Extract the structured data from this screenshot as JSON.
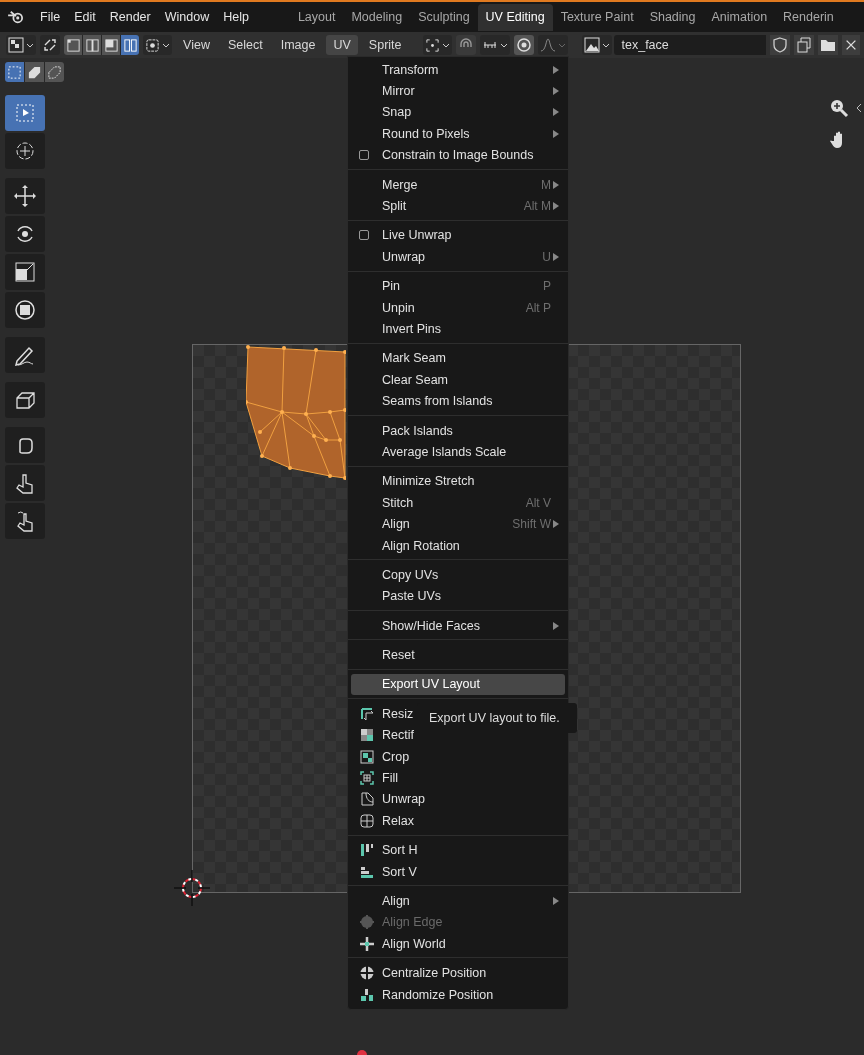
{
  "header": {
    "menus": [
      "File",
      "Edit",
      "Render",
      "Window",
      "Help"
    ],
    "workspaces": [
      {
        "label": "Layout",
        "selected": false
      },
      {
        "label": "Modeling",
        "selected": false
      },
      {
        "label": "Sculpting",
        "selected": false
      },
      {
        "label": "UV Editing",
        "selected": true
      },
      {
        "label": "Texture Paint",
        "selected": false
      },
      {
        "label": "Shading",
        "selected": false
      },
      {
        "label": "Animation",
        "selected": false
      },
      {
        "label": "Renderin",
        "selected": false
      }
    ]
  },
  "editor_header": {
    "select_modes": [
      {
        "selected": false
      },
      {
        "selected": false
      },
      {
        "selected": false
      },
      {
        "selected": true
      }
    ],
    "menus": [
      {
        "label": "View",
        "selected": false
      },
      {
        "label": "Select",
        "selected": false
      },
      {
        "label": "Image",
        "selected": false
      },
      {
        "label": "UV",
        "selected": true
      },
      {
        "label": "Sprite",
        "selected": false
      }
    ],
    "proportional_editing": {
      "on": true
    },
    "image_name": "tex_face"
  },
  "island_select_modes": [
    {
      "selected": true
    },
    {
      "selected": false
    },
    {
      "selected": false
    }
  ],
  "tools": [
    {
      "selected": true
    },
    {
      "selected": false
    },
    {
      "selected": false
    },
    {
      "selected": false
    },
    {
      "selected": false
    },
    {
      "selected": false
    },
    {
      "selected": false
    },
    {
      "selected": false
    },
    {
      "selected": false
    },
    {
      "selected": false
    },
    {
      "selected": false
    }
  ],
  "uv_menu": {
    "groups": [
      [
        {
          "label": "Transform",
          "kind": "plain",
          "submenu": true,
          "selected": false,
          "disabled": false
        },
        {
          "label": "Mirror",
          "kind": "plain",
          "submenu": true,
          "selected": false,
          "disabled": false
        },
        {
          "label": "Snap",
          "kind": "plain",
          "submenu": true,
          "selected": false,
          "disabled": false
        },
        {
          "label": "Round to Pixels",
          "kind": "plain",
          "submenu": true,
          "selected": false,
          "disabled": false
        },
        {
          "label": "Constrain to Image Bounds",
          "kind": "checkbox",
          "checked": false,
          "submenu": false,
          "selected": false,
          "disabled": false
        }
      ],
      [
        {
          "label": "Merge",
          "kind": "plain",
          "shortcut": "M",
          "submenu": true,
          "selected": false,
          "disabled": false
        },
        {
          "label": "Split",
          "kind": "plain",
          "shortcut": "Alt M",
          "submenu": true,
          "selected": false,
          "disabled": false
        }
      ],
      [
        {
          "label": "Live Unwrap",
          "kind": "checkbox",
          "checked": false,
          "submenu": false,
          "selected": false,
          "disabled": false
        },
        {
          "label": "Unwrap",
          "kind": "plain",
          "shortcut": "U",
          "submenu": true,
          "selected": false,
          "disabled": false
        }
      ],
      [
        {
          "label": "Pin",
          "kind": "plain",
          "shortcut": "P",
          "submenu": false,
          "selected": false,
          "disabled": false
        },
        {
          "label": "Unpin",
          "kind": "plain",
          "shortcut": "Alt P",
          "submenu": false,
          "selected": false,
          "disabled": false
        },
        {
          "label": "Invert Pins",
          "kind": "plain",
          "submenu": false,
          "selected": false,
          "disabled": false
        }
      ],
      [
        {
          "label": "Mark Seam",
          "kind": "plain",
          "submenu": false,
          "selected": false,
          "disabled": false
        },
        {
          "label": "Clear Seam",
          "kind": "plain",
          "submenu": false,
          "selected": false,
          "disabled": false
        },
        {
          "label": "Seams from Islands",
          "kind": "plain",
          "submenu": false,
          "selected": false,
          "disabled": false
        }
      ],
      [
        {
          "label": "Pack Islands",
          "kind": "plain",
          "submenu": false,
          "selected": false,
          "disabled": false
        },
        {
          "label": "Average Islands Scale",
          "kind": "plain",
          "submenu": false,
          "selected": false,
          "disabled": false
        }
      ],
      [
        {
          "label": "Minimize Stretch",
          "kind": "plain",
          "submenu": false,
          "selected": false,
          "disabled": false
        },
        {
          "label": "Stitch",
          "kind": "plain",
          "shortcut": "Alt V",
          "submenu": false,
          "selected": false,
          "disabled": false
        },
        {
          "label": "Align",
          "kind": "plain",
          "shortcut": "Shift W",
          "submenu": true,
          "selected": false,
          "disabled": false
        },
        {
          "label": "Align Rotation",
          "kind": "plain",
          "submenu": false,
          "selected": false,
          "disabled": false
        }
      ],
      [
        {
          "label": "Copy UVs",
          "kind": "plain",
          "submenu": false,
          "selected": false,
          "disabled": false
        },
        {
          "label": "Paste UVs",
          "kind": "plain",
          "submenu": false,
          "selected": false,
          "disabled": false
        }
      ],
      [
        {
          "label": "Show/Hide Faces",
          "kind": "plain",
          "submenu": true,
          "selected": false,
          "disabled": false
        }
      ],
      [
        {
          "label": "Reset",
          "kind": "plain",
          "submenu": false,
          "selected": false,
          "disabled": false
        }
      ],
      [
        {
          "label": "Export UV Layout",
          "kind": "plain",
          "submenu": false,
          "selected": true,
          "disabled": false
        }
      ],
      [
        {
          "label": "Resiz",
          "kind": "icon",
          "submenu": false,
          "selected": false,
          "disabled": false
        },
        {
          "label": "Rectif",
          "kind": "icon",
          "submenu": false,
          "selected": false,
          "disabled": false
        },
        {
          "label": "Crop",
          "kind": "icon",
          "submenu": false,
          "selected": false,
          "disabled": false
        },
        {
          "label": "Fill",
          "kind": "icon",
          "submenu": false,
          "selected": false,
          "disabled": false
        },
        {
          "label": "Unwrap",
          "kind": "icon",
          "submenu": false,
          "selected": false,
          "disabled": false
        },
        {
          "label": "Relax",
          "kind": "icon",
          "submenu": false,
          "selected": false,
          "disabled": false
        }
      ],
      [
        {
          "label": "Sort H",
          "kind": "icon",
          "submenu": false,
          "selected": false,
          "disabled": false
        },
        {
          "label": "Sort V",
          "kind": "icon",
          "submenu": false,
          "selected": false,
          "disabled": false
        }
      ],
      [
        {
          "label": "Align",
          "kind": "plain",
          "submenu": true,
          "selected": false,
          "disabled": false
        },
        {
          "label": "Align Edge",
          "kind": "icon",
          "submenu": false,
          "selected": false,
          "disabled": true
        },
        {
          "label": "Align World",
          "kind": "icon",
          "submenu": false,
          "selected": false,
          "disabled": false
        }
      ],
      [
        {
          "label": "Centralize Position",
          "kind": "icon",
          "submenu": false,
          "selected": false,
          "disabled": false
        },
        {
          "label": "Randomize Position",
          "kind": "icon",
          "submenu": false,
          "selected": false,
          "disabled": false
        }
      ]
    ]
  },
  "tooltip": "Export UV layout to file."
}
